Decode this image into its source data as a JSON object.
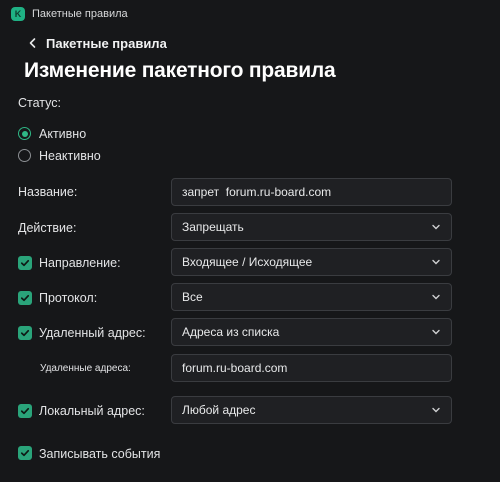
{
  "window": {
    "app_title": "Пакетные правила",
    "app_icon_letter": "K"
  },
  "header": {
    "breadcrumb": "Пакетные правила",
    "title": "Изменение пакетного правила"
  },
  "status": {
    "label": "Статус:",
    "options": [
      {
        "label": "Активно",
        "selected": true
      },
      {
        "label": "Неактивно",
        "selected": false
      }
    ]
  },
  "name": {
    "label": "Название:",
    "value": "запрет  forum.ru-board.com"
  },
  "action": {
    "label": "Действие:",
    "value": "Запрещать"
  },
  "direction": {
    "label": "Направление:",
    "checked": true,
    "value": "Входящее / Исходящее"
  },
  "protocol": {
    "label": "Протокол:",
    "checked": true,
    "value": "Все"
  },
  "remote": {
    "label": "Удаленный адрес:",
    "checked": true,
    "value": "Адреса из списка",
    "list_label": "Удаленные адреса:",
    "list_value": "forum.ru-board.com"
  },
  "local": {
    "label": "Локальный адрес:",
    "checked": true,
    "value": "Любой адрес"
  },
  "log_events": {
    "label": "Записывать события",
    "checked": true
  },
  "colors": {
    "accent": "#2fb886",
    "background": "#161719",
    "field": "#1f2023"
  }
}
